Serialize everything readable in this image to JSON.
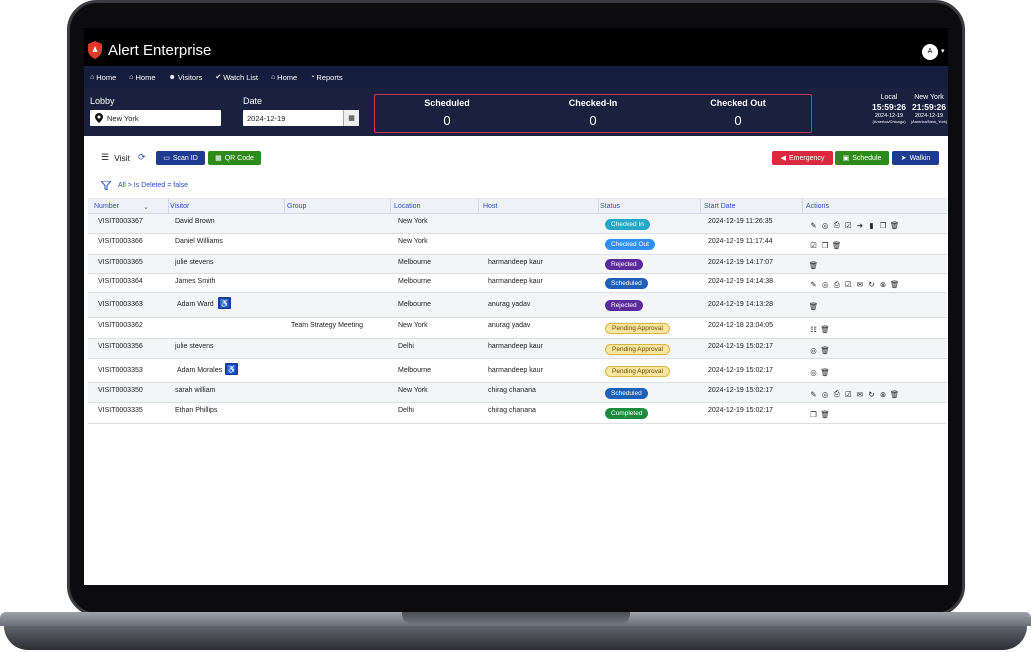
{
  "brand": {
    "name": "Alert Enterprise"
  },
  "user": {
    "initial": "A"
  },
  "nav": [
    {
      "label": "Home",
      "icon": "home-icon"
    },
    {
      "label": "Home",
      "icon": "home-icon"
    },
    {
      "label": "Visitors",
      "icon": "users-icon"
    },
    {
      "label": "Watch List",
      "icon": "check-icon"
    },
    {
      "label": "Home",
      "icon": "home-icon"
    },
    {
      "label": "Reports",
      "icon": "gauge-icon"
    }
  ],
  "info": {
    "lobby_label": "Lobby",
    "lobby_value": "New York",
    "date_label": "Date",
    "date_value": "2024-12-19",
    "stats": [
      {
        "title": "Scheduled",
        "value": "0"
      },
      {
        "title": "Checked-In",
        "value": "0"
      },
      {
        "title": "Checked Out",
        "value": "0"
      }
    ],
    "clocks": [
      {
        "label": "Local",
        "time": "15:59:26",
        "date": "2024-12-19",
        "zone": "(America/Chicago)"
      },
      {
        "label": "New York",
        "time": "21:59:26",
        "date": "2024-12-19",
        "zone": "(America/New_York)"
      }
    ]
  },
  "toolbar": {
    "visit_label": "Visit",
    "scan_label": "Scan ID",
    "qr_label": "QR Code",
    "emergency_label": "Emergency",
    "schedule_label": "Schedule",
    "walkin_label": "Walkin",
    "filter_text": "All > Is Deleted = false"
  },
  "columns": [
    "Number",
    "Visitor",
    "Group",
    "Location",
    "Host",
    "Status",
    "Start Date",
    "Actions"
  ],
  "rows": [
    {
      "number": "VISIT0003367",
      "visitor": "David Brown",
      "group": "",
      "location": "New York",
      "host": "",
      "status": "Checked In",
      "start": "2024-12-19 11:26:35",
      "wheelchair": false,
      "actions": [
        "edit",
        "user",
        "print",
        "checkbox",
        "checkout",
        "badge",
        "copy",
        "trash"
      ]
    },
    {
      "number": "VISIT0003366",
      "visitor": "Daniel Williams",
      "group": "",
      "location": "New York",
      "host": "",
      "status": "Checked Out",
      "start": "2024-12-19 11:17:44",
      "wheelchair": false,
      "actions": [
        "checkbox",
        "copy",
        "trash"
      ]
    },
    {
      "number": "VISIT0003365",
      "visitor": "julie stevens",
      "group": "",
      "location": "Melbourne",
      "host": "harmandeep kaur",
      "status": "Rejected",
      "start": "2024-12-19 14:17:07",
      "wheelchair": false,
      "actions": [
        "trash"
      ]
    },
    {
      "number": "VISIT0003364",
      "visitor": "James Smith",
      "group": "",
      "location": "Melbourne",
      "host": "harmandeep kaur",
      "status": "Scheduled",
      "start": "2024-12-19 14:14:38",
      "wheelchair": false,
      "actions": [
        "edit",
        "user",
        "print",
        "checkbox",
        "mail",
        "refresh",
        "cancel",
        "trash"
      ]
    },
    {
      "number": "VISIT0003363",
      "visitor": "Adam Ward",
      "group": "",
      "location": "Melbourne",
      "host": "anurag yadav",
      "status": "Rejected",
      "start": "2024-12-19 14:13:28",
      "wheelchair": true,
      "actions": [
        "trash"
      ]
    },
    {
      "number": "VISIT0003362",
      "visitor": "",
      "group": "Team Strategy Meeting",
      "location": "New York",
      "host": "anurag yadav",
      "status": "Pending Approval",
      "start": "2024-12-18 23:04:05",
      "wheelchair": false,
      "actions": [
        "group",
        "trash"
      ]
    },
    {
      "number": "VISIT0003356",
      "visitor": "julie stevens",
      "group": "",
      "location": "Delhi",
      "host": "harmandeep kaur",
      "status": "Pending Approval",
      "start": "2024-12-19 15:02:17",
      "wheelchair": false,
      "actions": [
        "user",
        "trash"
      ]
    },
    {
      "number": "VISIT0003353",
      "visitor": "Adam Morales",
      "group": "",
      "location": "Melbourne",
      "host": "harmandeep kaur",
      "status": "Pending Approval",
      "start": "2024-12-19 15:02:17",
      "wheelchair": true,
      "actions": [
        "user",
        "trash"
      ]
    },
    {
      "number": "VISIT0003350",
      "visitor": "sarah william",
      "group": "",
      "location": "New York",
      "host": "chirag chanana",
      "status": "Scheduled",
      "start": "2024-12-19 15:02:17",
      "wheelchair": false,
      "actions": [
        "edit",
        "user",
        "print",
        "checkbox",
        "mail",
        "refresh",
        "cancel",
        "trash"
      ]
    },
    {
      "number": "VISIT0003335",
      "visitor": "Ethan Phillips",
      "group": "",
      "location": "Delhi",
      "host": "chirag chanana",
      "status": "Completed",
      "start": "2024-12-19 15:02:17",
      "wheelchair": false,
      "actions": [
        "copy",
        "trash"
      ]
    }
  ],
  "status_colors": {
    "Checked In": {
      "bg": "#25a8c6",
      "fg": "#ffffff"
    },
    "Checked Out": {
      "bg": "#2f8ff0",
      "fg": "#ffffff"
    },
    "Rejected": {
      "bg": "#5b2a9d",
      "fg": "#ffffff"
    },
    "Scheduled": {
      "bg": "#1f5fb8",
      "fg": "#ffffff"
    },
    "Pending Approval": {
      "bg": "#fbe6a0",
      "fg": "#6b4f00"
    },
    "Completed": {
      "bg": "#1e8a3c",
      "fg": "#ffffff"
    }
  },
  "colors": {
    "emergency": "#d8293f",
    "schedule": "#2f8a1c",
    "walkin": "#1e3b8f",
    "scan": "#1e3b8f",
    "qr": "#2f8a1c"
  }
}
